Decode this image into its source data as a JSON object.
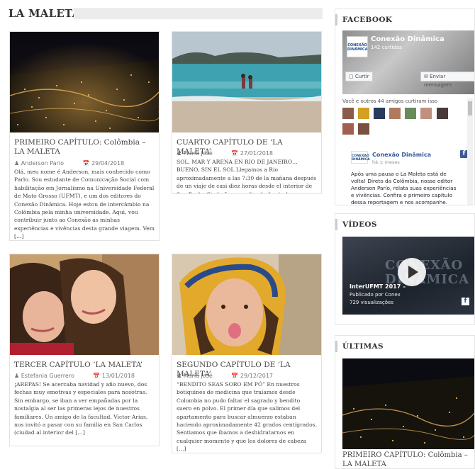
{
  "section": {
    "title": "LA MALETA"
  },
  "posts": [
    {
      "title": "PRIMEIRO CAPÍTULO: Colômbia – LA MALETA",
      "author": "Anderson Parlo",
      "date": "29/04/2018",
      "excerpt": "Olá, meu nome é Anderson, mais conhecido como Parlo. Sou estudante de Comunicação Social com habilitação em Jornalismo na Universidade Federal de Mato Grosso (UFMT), e um dos editores do Conexão Dinâmica. Hoje estou de intercâmbio na Colômbia pela minha universidade. Aqui, vou contribuir junto ao Conexão as minhas experiências e vivências desta grande viagem. Vem […]"
    },
    {
      "title": "CUARTO CAPÍTULO DE ‘LA MALETA’",
      "author": "María José",
      "date": "27/01/2018",
      "excerpt": "SOL, MAR Y ARENA EN RIO DE JANEIRO… BUENO, SIN EL SOL   Llegamos a Rio aproximadamente a las 7:30 de la mañana después de un viaje de casi diez horas desde el interior de Sao Paulo. Sin bañarnos, oliendo feo (sabemos que ya hemos dicho esto antes, al parecer es una situación frecuente) […]"
    },
    {
      "title": "TERCER CAPÍTULO ‘LA MALETA’",
      "author": "Estefania Guerrero",
      "date": "13/01/2018",
      "excerpt": "¡AREPAS!  Se acercaba navidad y año nuevo, dos fechas muy emotivas y especiales para nosotras. Sin embargo, se iban a ver empañadas por la nostalgia al ser las primeras lejos de nuestros familiares. Un amigo de la facultad, Victor Arias, nos invitó a pasar con su familia en San Carlos (ciudad al interior del […]"
    },
    {
      "title": "SEGUNDO CAPÍTULO DE ‘LA MALETA’",
      "author": "María José",
      "date": "29/12/2017",
      "excerpt": "“BENDITO SEAS SORO EM PÓ”  En nuestros botiquines de medicina que traíamos desde Colombia no pudo faltar el sagrado y bendito suero en polvo. El primer día que salimos del apartamento para buscar almuerzo estaban haciendo aproximadamente 42 grados centígrados. Sentiamos que íbamos a deshidratarnos en cualquier momento y que los dolores de cabeza […]"
    }
  ],
  "facebook": {
    "title": "FACEBOOK",
    "page_name": "Conexão Dinâmica",
    "likes": "142 curtidas",
    "like_button": "Curtir",
    "message_button": "Enviar mensagem",
    "friends_text": "Você e outros 44 amigos curtiram isso",
    "logo_text": "CONEXÃO DINÂMICA",
    "post_author": "Conexão Dinâmica",
    "post_time": "há ± meses",
    "post_text": "Após uma pausa o La Maleta está de volta! Direto da Colômbia, nosso editor Anderson Parlo, relata suas experiências e vivências. Confira o primeiro capítulo dessa reportagem e nos acompanhe."
  },
  "videos": {
    "title": "VÍDEOS",
    "video_title": "InterUFMT 2017 –",
    "published_by": "Publicado por Conex",
    "views": "729 visualizações",
    "watermark_1": "CONEXÃO",
    "watermark_2": "DINÂMICA"
  },
  "latest": {
    "title": "ÚLTIMAS",
    "post_title": "PRIMEIRO CAPÍTULO: Colômbia – LA MALETA"
  }
}
